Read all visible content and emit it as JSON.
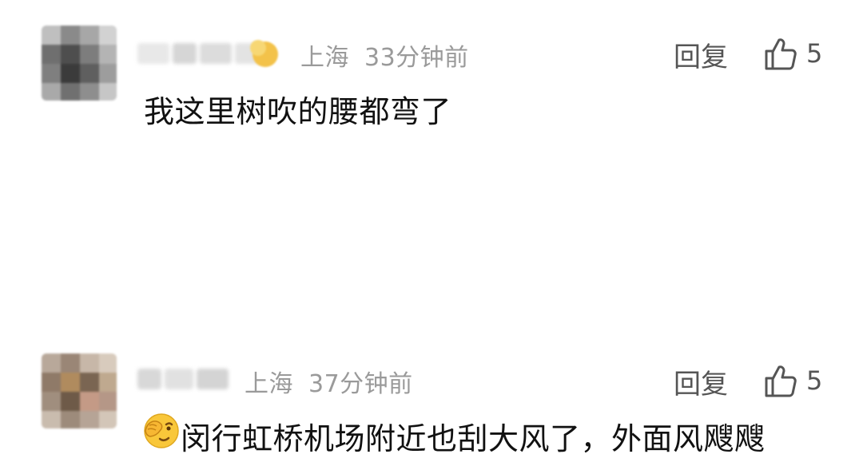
{
  "comments": [
    {
      "username": "",
      "location": "上海",
      "time": "33分钟前",
      "reply_label": "回复",
      "like_count": "5",
      "text": "我这里树吹的腰都弯了",
      "has_badge": true
    },
    {
      "username": "",
      "location": "上海",
      "time": "37分钟前",
      "reply_label": "回复",
      "like_count": "5",
      "text": "闵行虹桥机场附近也刮大风了，外面风飕飕",
      "emoji": "face-with-hand-over-eye-icon"
    }
  ],
  "colors": {
    "meta": "#9a9a9a",
    "action": "#555555",
    "text": "#111111"
  }
}
